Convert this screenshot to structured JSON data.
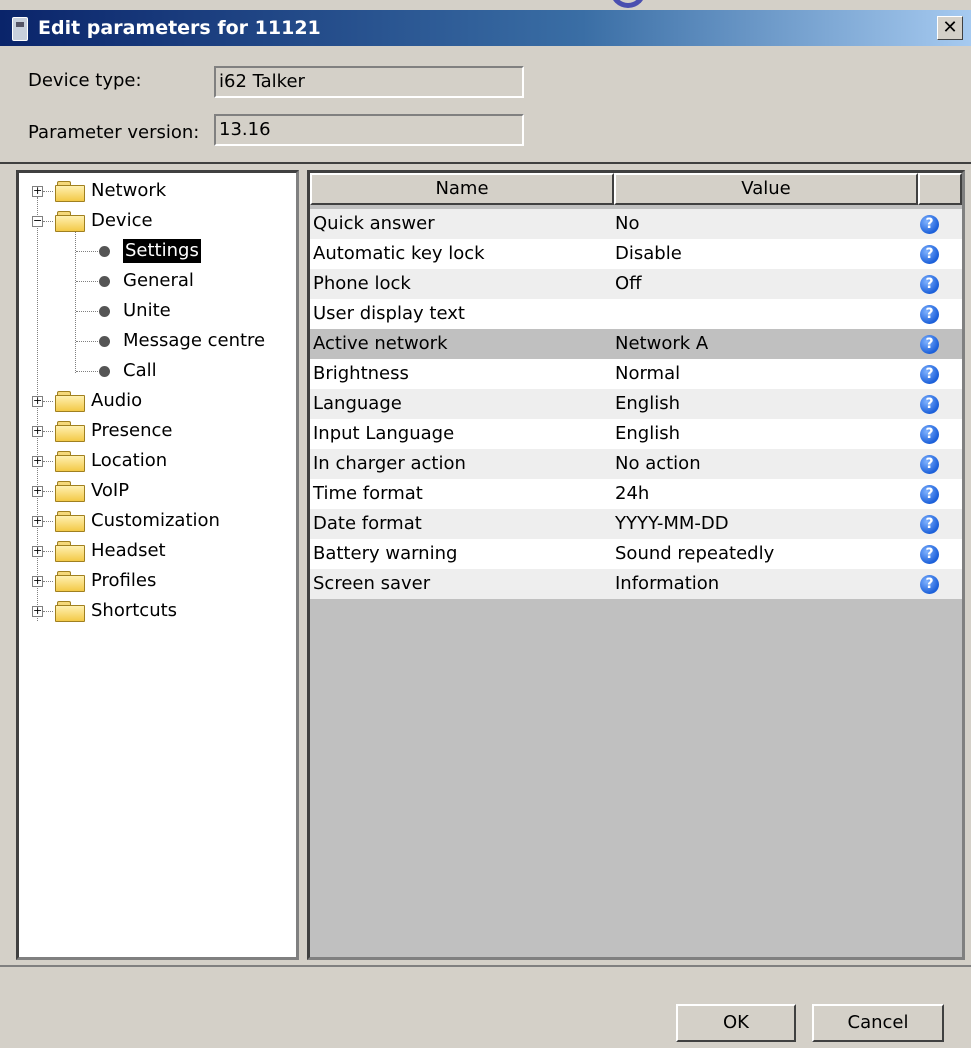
{
  "window": {
    "title": "Edit parameters for 11121",
    "close_glyph": "✕"
  },
  "fields": {
    "device_type_label": "Device type:",
    "device_type_value": "i62 Talker",
    "param_version_label": "Parameter version:",
    "param_version_value": "13.16"
  },
  "tree": {
    "folders": [
      "Network",
      "Device",
      "Audio",
      "Presence",
      "Location",
      "VoIP",
      "Customization",
      "Headset",
      "Profiles",
      "Shortcuts"
    ],
    "device_children": [
      "Settings",
      "General",
      "Unite",
      "Message centre",
      "Call"
    ],
    "selected": "Settings"
  },
  "table": {
    "headers": {
      "name": "Name",
      "value": "Value"
    },
    "rows": [
      {
        "name": "Quick answer",
        "value": "No"
      },
      {
        "name": "Automatic key lock",
        "value": "Disable"
      },
      {
        "name": "Phone lock",
        "value": "Off"
      },
      {
        "name": "User display text",
        "value": ""
      },
      {
        "name": "Active network",
        "value": "Network A"
      },
      {
        "name": "Brightness",
        "value": "Normal"
      },
      {
        "name": "Language",
        "value": "English"
      },
      {
        "name": "Input Language",
        "value": "English"
      },
      {
        "name": "In charger action",
        "value": "No action"
      },
      {
        "name": "Time format",
        "value": "24h"
      },
      {
        "name": "Date format",
        "value": "YYYY-MM-DD"
      },
      {
        "name": "Battery warning",
        "value": "Sound repeatedly"
      },
      {
        "name": "Screen saver",
        "value": "Information"
      }
    ],
    "selected_row": 4,
    "help_glyph": "?"
  },
  "buttons": {
    "ok": "OK",
    "cancel": "Cancel"
  },
  "colors": {
    "titlebar": "#0a246a",
    "row_selected": "#c0c0c0",
    "help_icon": "#1b5fd9"
  }
}
